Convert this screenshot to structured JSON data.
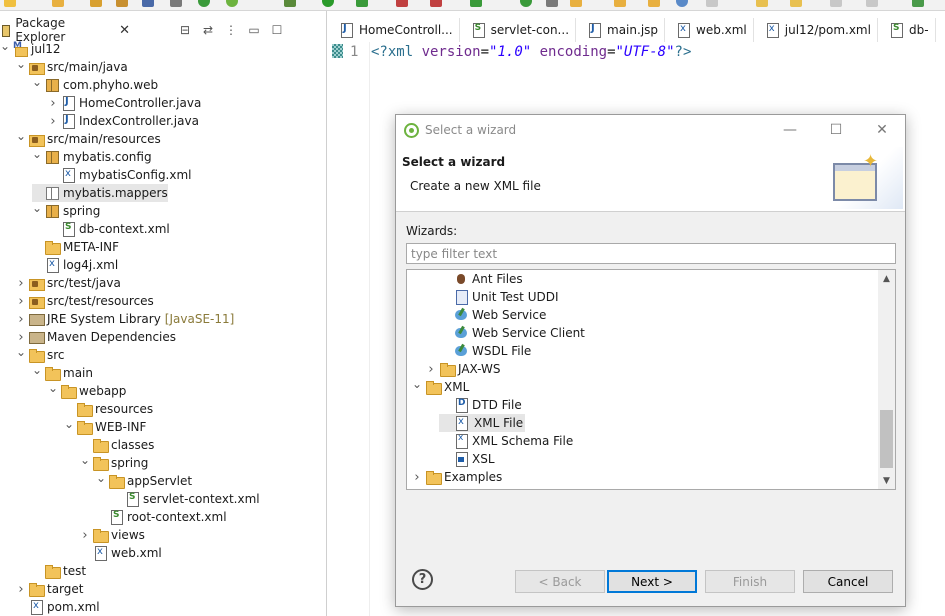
{
  "package_explorer": {
    "title": "Package Explorer",
    "tree": [
      {
        "label": "jul12",
        "icon": "project-icon",
        "level": 0,
        "chevron": "down"
      },
      {
        "label": "src/main/java",
        "icon": "source-folder-icon",
        "level": 1,
        "chevron": "down"
      },
      {
        "label": "com.phyho.web",
        "icon": "package-icon",
        "level": 2,
        "chevron": "down"
      },
      {
        "label": "HomeController.java",
        "icon": "java-file-icon",
        "level": 3,
        "chevron": "right"
      },
      {
        "label": "IndexController.java",
        "icon": "java-file-icon",
        "level": 3,
        "chevron": "right"
      },
      {
        "label": "src/main/resources",
        "icon": "source-folder-icon",
        "level": 1,
        "chevron": "down"
      },
      {
        "label": "mybatis.config",
        "icon": "package-icon",
        "level": 2,
        "chevron": "down"
      },
      {
        "label": "mybatisConfig.xml",
        "icon": "xml-file-icon",
        "level": 3,
        "chevron": ""
      },
      {
        "label": "mybatis.mappers",
        "icon": "empty-package-icon",
        "level": 2,
        "chevron": "",
        "selected": true
      },
      {
        "label": "spring",
        "icon": "package-icon",
        "level": 2,
        "chevron": "down"
      },
      {
        "label": "db-context.xml",
        "icon": "spring-xml-icon",
        "level": 3,
        "chevron": ""
      },
      {
        "label": "META-INF",
        "icon": "folder-icon",
        "level": 2,
        "chevron": ""
      },
      {
        "label": "log4j.xml",
        "icon": "xml-file-icon",
        "level": 2,
        "chevron": ""
      },
      {
        "label": "src/test/java",
        "icon": "source-folder-icon",
        "level": 1,
        "chevron": "right"
      },
      {
        "label": "src/test/resources",
        "icon": "source-folder-icon",
        "level": 1,
        "chevron": "right"
      },
      {
        "label": "JRE System Library",
        "suffix": "[JavaSE-11]",
        "icon": "library-icon",
        "level": 1,
        "chevron": "right"
      },
      {
        "label": "Maven Dependencies",
        "icon": "library-icon",
        "level": 1,
        "chevron": "right"
      },
      {
        "label": "src",
        "icon": "folder-icon",
        "level": 1,
        "chevron": "down"
      },
      {
        "label": "main",
        "icon": "spring-folder-icon",
        "level": 2,
        "chevron": "down"
      },
      {
        "label": "webapp",
        "icon": "spring-folder-icon",
        "level": 3,
        "chevron": "down"
      },
      {
        "label": "resources",
        "icon": "folder-icon",
        "level": 4,
        "chevron": ""
      },
      {
        "label": "WEB-INF",
        "icon": "spring-folder-icon",
        "level": 4,
        "chevron": "down"
      },
      {
        "label": "classes",
        "icon": "folder-icon",
        "level": 5,
        "chevron": ""
      },
      {
        "label": "spring",
        "icon": "spring-folder-icon",
        "level": 5,
        "chevron": "down"
      },
      {
        "label": "appServlet",
        "icon": "spring-folder-icon",
        "level": 6,
        "chevron": "down"
      },
      {
        "label": "servlet-context.xml",
        "icon": "spring-xml-icon",
        "level": 7,
        "chevron": ""
      },
      {
        "label": "root-context.xml",
        "icon": "spring-xml-icon",
        "level": 6,
        "chevron": ""
      },
      {
        "label": "views",
        "icon": "folder-icon",
        "level": 5,
        "chevron": "right"
      },
      {
        "label": "web.xml",
        "icon": "xml-file-icon",
        "level": 5,
        "chevron": ""
      },
      {
        "label": "test",
        "icon": "folder-icon",
        "level": 2,
        "chevron": ""
      },
      {
        "label": "target",
        "icon": "folder-icon",
        "level": 1,
        "chevron": "right"
      },
      {
        "label": "pom.xml",
        "icon": "maven-file-icon",
        "level": 1,
        "chevron": ""
      }
    ]
  },
  "editor": {
    "tabs": [
      {
        "label": "HomeControll...",
        "icon": "java-file-icon"
      },
      {
        "label": "servlet-con...",
        "icon": "spring-xml-icon"
      },
      {
        "label": "main.jsp",
        "icon": "jsp-file-icon"
      },
      {
        "label": "web.xml",
        "icon": "xml-file-icon"
      },
      {
        "label": "jul12/pom.xml",
        "icon": "maven-file-icon"
      },
      {
        "label": "db-",
        "icon": "spring-xml-icon"
      }
    ],
    "line_number": "1",
    "code": {
      "open": "<?xml ",
      "attr1": "version",
      "eq1": "=",
      "val1": "\"1.0\"",
      "sp": " ",
      "attr2": "encoding",
      "eq2": "=",
      "val2": "\"UTF-8\"",
      "close": "?>"
    }
  },
  "dialog": {
    "window_title": "Select a wizard",
    "heading": "Select a wizard",
    "description": "Create a new XML file",
    "wizards_label": "Wizards:",
    "filter_placeholder": "type filter text",
    "tree": [
      {
        "label": "Ant Files",
        "icon": "ant-icon",
        "level": 2,
        "chevron": ""
      },
      {
        "label": "Unit Test UDDI",
        "icon": "unit-test-icon",
        "level": 2,
        "chevron": ""
      },
      {
        "label": "Web Service",
        "icon": "web-service-icon",
        "level": 2,
        "chevron": ""
      },
      {
        "label": "Web Service Client",
        "icon": "web-service-icon",
        "level": 2,
        "chevron": ""
      },
      {
        "label": "WSDL File",
        "icon": "wsdl-icon",
        "level": 2,
        "chevron": ""
      },
      {
        "label": "JAX-WS",
        "icon": "folder-icon",
        "level": 1,
        "chevron": "right"
      },
      {
        "label": "XML",
        "icon": "folder-icon",
        "level": 0,
        "chevron": "down"
      },
      {
        "label": "DTD File",
        "icon": "dtd-file-icon",
        "level": 2,
        "chevron": ""
      },
      {
        "label": "XML File",
        "icon": "xml-file-icon",
        "level": 2,
        "chevron": "",
        "selected": true
      },
      {
        "label": "XML Schema File",
        "icon": "xsd-file-icon",
        "level": 2,
        "chevron": ""
      },
      {
        "label": "XSL",
        "icon": "xsl-file-icon",
        "level": 2,
        "chevron": ""
      },
      {
        "label": "Examples",
        "icon": "folder-icon",
        "level": 0,
        "chevron": "right"
      }
    ],
    "buttons": {
      "help": "?",
      "back": "< Back",
      "next": "Next >",
      "finish": "Finish",
      "cancel": "Cancel"
    }
  }
}
